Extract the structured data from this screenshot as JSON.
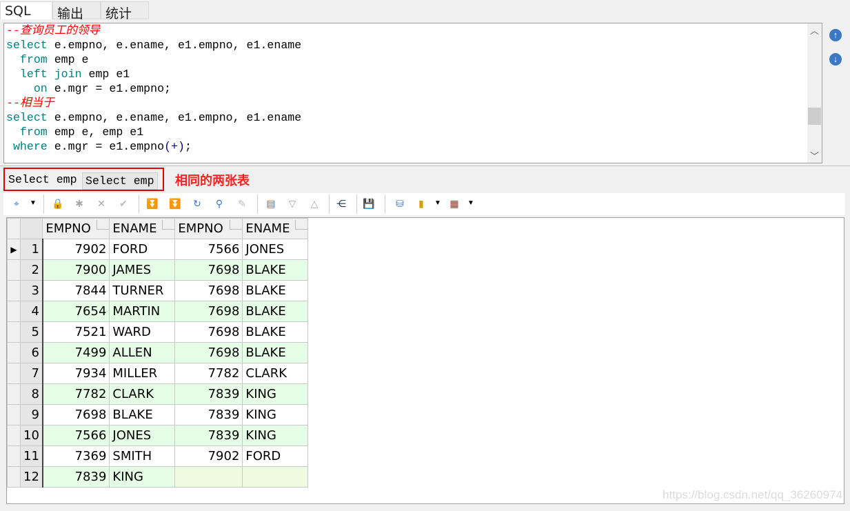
{
  "top_tabs": [
    "SQL",
    "输出",
    "统计表"
  ],
  "editor": {
    "lines": [
      [
        {
          "t": "--查询员工的领导",
          "c": "cm"
        }
      ],
      [
        {
          "t": "select",
          "c": "kw"
        },
        {
          "t": " e.empno, e.ename, e1.empno, e1.ename",
          "c": ""
        }
      ],
      [
        {
          "t": "  ",
          "c": ""
        },
        {
          "t": "from",
          "c": "kw"
        },
        {
          "t": " emp e",
          "c": ""
        }
      ],
      [
        {
          "t": "  ",
          "c": ""
        },
        {
          "t": "left join",
          "c": "kw"
        },
        {
          "t": " emp e1",
          "c": ""
        }
      ],
      [
        {
          "t": "    ",
          "c": ""
        },
        {
          "t": "on",
          "c": "kw"
        },
        {
          "t": " e.mgr = e1.empno;",
          "c": ""
        }
      ],
      [
        {
          "t": "--相当于",
          "c": "cm"
        }
      ],
      [
        {
          "t": "select",
          "c": "kw"
        },
        {
          "t": " e.empno, e.ename, e1.empno, e1.ename",
          "c": ""
        }
      ],
      [
        {
          "t": "  ",
          "c": ""
        },
        {
          "t": "from",
          "c": "kw"
        },
        {
          "t": " emp e, emp e1",
          "c": ""
        }
      ],
      [
        {
          "t": " ",
          "c": ""
        },
        {
          "t": "where",
          "c": "kw"
        },
        {
          "t": " e.mgr = e1.empno",
          "c": ""
        },
        {
          "t": "(+)",
          "c": "op"
        },
        {
          "t": ";",
          "c": ""
        }
      ]
    ]
  },
  "result_tabs": [
    "Select emp",
    "Select emp"
  ],
  "annotation": "相同的两张表",
  "grid": {
    "columns": [
      "EMPNO",
      "ENAME",
      "EMPNO",
      "ENAME"
    ],
    "rows": [
      [
        "1",
        "7902",
        "FORD",
        "7566",
        "JONES"
      ],
      [
        "2",
        "7900",
        "JAMES",
        "7698",
        "BLAKE"
      ],
      [
        "3",
        "7844",
        "TURNER",
        "7698",
        "BLAKE"
      ],
      [
        "4",
        "7654",
        "MARTIN",
        "7698",
        "BLAKE"
      ],
      [
        "5",
        "7521",
        "WARD",
        "7698",
        "BLAKE"
      ],
      [
        "6",
        "7499",
        "ALLEN",
        "7698",
        "BLAKE"
      ],
      [
        "7",
        "7934",
        "MILLER",
        "7782",
        "CLARK"
      ],
      [
        "8",
        "7782",
        "CLARK",
        "7839",
        "KING"
      ],
      [
        "9",
        "7698",
        "BLAKE",
        "7839",
        "KING"
      ],
      [
        "10",
        "7566",
        "JONES",
        "7839",
        "KING"
      ],
      [
        "11",
        "7369",
        "SMITH",
        "7902",
        "FORD"
      ],
      [
        "12",
        "7839",
        "KING",
        "",
        ""
      ]
    ]
  },
  "watermark": "https://blog.csdn.net/qq_36260974",
  "colors": {
    "accent": "#ff0000",
    "keyword": "#008080",
    "alt_row": "#e6fde6"
  }
}
